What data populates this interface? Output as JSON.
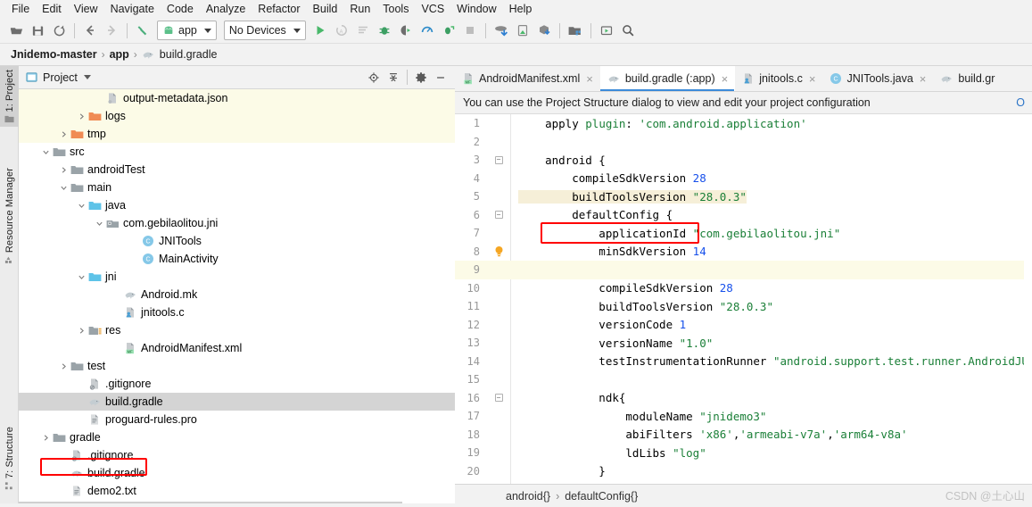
{
  "menu": {
    "items": [
      "File",
      "Edit",
      "View",
      "Navigate",
      "Code",
      "Analyze",
      "Refactor",
      "Build",
      "Run",
      "Tools",
      "VCS",
      "Window",
      "Help"
    ]
  },
  "toolbar": {
    "icons": [
      "open-folder-icon",
      "save-icon",
      "sync-icon",
      "back-arrow-icon",
      "forward-arrow-icon",
      "build-hammer-icon"
    ],
    "run_config": "app",
    "device_selector": "No Devices",
    "right_icons": [
      "run-icon",
      "apply-changes-icon",
      "apply-code-changes-icon",
      "debug-icon",
      "debug-attach-icon",
      "profiler-icon",
      "attach-debugger-icon",
      "stop-icon",
      "sdk-manager-icon",
      "avd-manager-icon",
      "sync-gradle-icon",
      "project-structure-icon",
      "layout-inspector-icon",
      "search-everywhere-icon"
    ]
  },
  "breadcrumb": {
    "project": "Jnidemo-master",
    "module": "app",
    "file": "build.gradle",
    "separator": "›"
  },
  "sidebar": {
    "tabs": [
      {
        "label": "1: Project",
        "icon": "project-folder-icon",
        "active": true
      },
      {
        "label": "Resource Manager",
        "icon": "resource-manager-icon",
        "active": false
      },
      {
        "label": "7: Structure",
        "icon": "structure-icon",
        "active": false
      }
    ]
  },
  "project_panel": {
    "title": "Project",
    "actions": [
      "locate-target-icon",
      "collapse-all-icon",
      "settings-gear-icon",
      "hide-panel-icon"
    ],
    "tree": [
      {
        "label": "output-metadata.json",
        "icon": "json-file-icon",
        "indent": 5,
        "twist": "",
        "highlight": "yellow"
      },
      {
        "label": "logs",
        "icon": "orange-folder-icon",
        "indent": 4,
        "twist": ">",
        "highlight": "yellow"
      },
      {
        "label": "tmp",
        "icon": "orange-folder-icon",
        "indent": 3,
        "twist": ">",
        "highlight": "yellow"
      },
      {
        "label": "src",
        "icon": "gray-folder-icon",
        "indent": 2,
        "twist": "v",
        "highlight": ""
      },
      {
        "label": "androidTest",
        "icon": "gray-folder-icon",
        "indent": 3,
        "twist": ">",
        "highlight": ""
      },
      {
        "label": "main",
        "icon": "gray-folder-icon",
        "indent": 3,
        "twist": "v",
        "highlight": ""
      },
      {
        "label": "java",
        "icon": "blue-folder-icon",
        "indent": 4,
        "twist": "v",
        "highlight": ""
      },
      {
        "label": "com.gebilaolitou.jni",
        "icon": "package-icon",
        "indent": 5,
        "twist": "v",
        "highlight": ""
      },
      {
        "label": "JNITools",
        "icon": "class-icon",
        "indent": 7,
        "twist": "",
        "highlight": ""
      },
      {
        "label": "MainActivity",
        "icon": "class-icon",
        "indent": 7,
        "twist": "",
        "highlight": ""
      },
      {
        "label": "jni",
        "icon": "blue-folder-icon",
        "indent": 4,
        "twist": "v",
        "highlight": ""
      },
      {
        "label": "Android.mk",
        "icon": "gradle-elephant-icon",
        "indent": 6,
        "twist": "",
        "highlight": ""
      },
      {
        "label": "jnitools.c",
        "icon": "c-file-icon",
        "indent": 6,
        "twist": "",
        "highlight": ""
      },
      {
        "label": "res",
        "icon": "res-folder-icon",
        "indent": 4,
        "twist": ">",
        "highlight": ""
      },
      {
        "label": "AndroidManifest.xml",
        "icon": "manifest-icon",
        "indent": 6,
        "twist": "",
        "highlight": ""
      },
      {
        "label": "test",
        "icon": "gray-folder-icon",
        "indent": 3,
        "twist": ">",
        "highlight": ""
      },
      {
        "label": ".gitignore",
        "icon": "gitignore-icon",
        "indent": 4,
        "twist": "",
        "highlight": ""
      },
      {
        "label": "build.gradle",
        "icon": "gradle-elephant-icon",
        "indent": 4,
        "twist": "",
        "highlight": "selected"
      },
      {
        "label": "proguard-rules.pro",
        "icon": "text-file-icon",
        "indent": 4,
        "twist": "",
        "highlight": ""
      },
      {
        "label": "gradle",
        "icon": "gray-folder-icon",
        "indent": 2,
        "twist": ">",
        "highlight": ""
      },
      {
        "label": ".gitignore",
        "icon": "gitignore-icon",
        "indent": 3,
        "twist": "",
        "highlight": ""
      },
      {
        "label": "build.gradle",
        "icon": "gradle-elephant-icon",
        "indent": 3,
        "twist": "",
        "highlight": ""
      },
      {
        "label": "demo2.txt",
        "icon": "text-file-icon",
        "indent": 3,
        "twist": "",
        "highlight": ""
      }
    ]
  },
  "editor": {
    "tabs": [
      {
        "label": "AndroidManifest.xml",
        "icon": "manifest-icon",
        "active": false
      },
      {
        "label": "build.gradle (:app)",
        "icon": "gradle-elephant-icon",
        "active": true
      },
      {
        "label": "jnitools.c",
        "icon": "c-file-icon",
        "active": false
      },
      {
        "label": "JNITools.java",
        "icon": "class-icon",
        "active": false
      },
      {
        "label": "build.gr",
        "icon": "gradle-elephant-icon",
        "active": false
      }
    ],
    "close_glyph": "×",
    "notification": {
      "text": "You can use the Project Structure dialog to view and edit your project configuration",
      "link": "O"
    },
    "lines": [
      {
        "n": "1",
        "fold": "",
        "bulb": false,
        "caret": false,
        "tan": false,
        "tokens": [
          {
            "t": "    apply ",
            "c": "kw"
          },
          {
            "t": "plugin",
            "c": "attr"
          },
          {
            "t": ": ",
            "c": "kw"
          },
          {
            "t": "'com.android.application'",
            "c": "str"
          }
        ]
      },
      {
        "n": "2",
        "fold": "",
        "bulb": false,
        "caret": false,
        "tan": false,
        "tokens": []
      },
      {
        "n": "3",
        "fold": "-",
        "bulb": false,
        "caret": false,
        "tan": false,
        "tokens": [
          {
            "t": "    android {",
            "c": "kw"
          }
        ]
      },
      {
        "n": "4",
        "fold": "",
        "bulb": false,
        "caret": false,
        "tan": false,
        "tokens": [
          {
            "t": "        compileSdkVersion ",
            "c": "kw"
          },
          {
            "t": "28",
            "c": "num"
          }
        ]
      },
      {
        "n": "5",
        "fold": "",
        "bulb": false,
        "caret": false,
        "tan": true,
        "tokens": [
          {
            "t": "        buildToolsVersion ",
            "c": "kw"
          },
          {
            "t": "\"28.0.3\"",
            "c": "str"
          }
        ]
      },
      {
        "n": "6",
        "fold": "-",
        "bulb": false,
        "caret": false,
        "tan": false,
        "tokens": [
          {
            "t": "        defaultConfig {",
            "c": "kw"
          }
        ]
      },
      {
        "n": "7",
        "fold": "",
        "bulb": false,
        "caret": false,
        "tan": false,
        "tokens": [
          {
            "t": "            applicationId ",
            "c": "kw"
          },
          {
            "t": "\"com.gebilaolitou.jni\"",
            "c": "str"
          }
        ]
      },
      {
        "n": "8",
        "fold": "",
        "bulb": true,
        "caret": false,
        "tan": false,
        "tokens": [
          {
            "t": "            minSdkVersion ",
            "c": "kw"
          },
          {
            "t": "14",
            "c": "num"
          }
        ]
      },
      {
        "n": "9",
        "fold": "",
        "bulb": false,
        "caret": true,
        "tan": false,
        "tokens": []
      },
      {
        "n": "10",
        "fold": "",
        "bulb": false,
        "caret": false,
        "tan": false,
        "tokens": [
          {
            "t": "            compileSdkVersion ",
            "c": "kw"
          },
          {
            "t": "28",
            "c": "num"
          }
        ]
      },
      {
        "n": "11",
        "fold": "",
        "bulb": false,
        "caret": false,
        "tan": false,
        "tokens": [
          {
            "t": "            buildToolsVersion ",
            "c": "kw"
          },
          {
            "t": "\"28.0.3\"",
            "c": "str"
          }
        ]
      },
      {
        "n": "12",
        "fold": "",
        "bulb": false,
        "caret": false,
        "tan": false,
        "tokens": [
          {
            "t": "            versionCode ",
            "c": "kw"
          },
          {
            "t": "1",
            "c": "num"
          }
        ]
      },
      {
        "n": "13",
        "fold": "",
        "bulb": false,
        "caret": false,
        "tan": false,
        "tokens": [
          {
            "t": "            versionName ",
            "c": "kw"
          },
          {
            "t": "\"1.0\"",
            "c": "str"
          }
        ]
      },
      {
        "n": "14",
        "fold": "",
        "bulb": false,
        "caret": false,
        "tan": false,
        "tokens": [
          {
            "t": "            testInstrumentationRunner ",
            "c": "kw"
          },
          {
            "t": "\"android.support.test.runner.AndroidJUn",
            "c": "str"
          }
        ]
      },
      {
        "n": "15",
        "fold": "",
        "bulb": false,
        "caret": false,
        "tan": false,
        "tokens": []
      },
      {
        "n": "16",
        "fold": "-",
        "bulb": false,
        "caret": false,
        "tan": false,
        "tokens": [
          {
            "t": "            ndk{",
            "c": "kw"
          }
        ]
      },
      {
        "n": "17",
        "fold": "",
        "bulb": false,
        "caret": false,
        "tan": false,
        "tokens": [
          {
            "t": "                moduleName ",
            "c": "kw"
          },
          {
            "t": "\"jnidemo3\"",
            "c": "str"
          }
        ]
      },
      {
        "n": "18",
        "fold": "",
        "bulb": false,
        "caret": false,
        "tan": false,
        "tokens": [
          {
            "t": "                abiFilters ",
            "c": "kw"
          },
          {
            "t": "'x86'",
            "c": "str"
          },
          {
            "t": ",",
            "c": "kw"
          },
          {
            "t": "'armeabi-v7a'",
            "c": "str"
          },
          {
            "t": ",",
            "c": "kw"
          },
          {
            "t": "'arm64-v8a'",
            "c": "str"
          }
        ]
      },
      {
        "n": "19",
        "fold": "",
        "bulb": false,
        "caret": false,
        "tan": false,
        "tokens": [
          {
            "t": "                ldLibs ",
            "c": "kw"
          },
          {
            "t": "\"log\"",
            "c": "str"
          }
        ]
      },
      {
        "n": "20",
        "fold": "",
        "bulb": false,
        "caret": false,
        "tan": false,
        "tokens": [
          {
            "t": "            }",
            "c": "kw"
          }
        ]
      }
    ],
    "status_breadcrumb": {
      "parent": "android{}",
      "child": "defaultConfig{}",
      "separator": "›"
    }
  },
  "watermark": "CSDN @土心山",
  "colors": {
    "accent_blue": "#3c8bd9",
    "annotation_red": "#ff0000",
    "string_green": "#1a7f37",
    "number_blue": "#1750eb",
    "highlight_yellow": "#fcfbe7",
    "highlight_tan": "#f6efd8",
    "selection_gray": "#d4d4d4"
  }
}
